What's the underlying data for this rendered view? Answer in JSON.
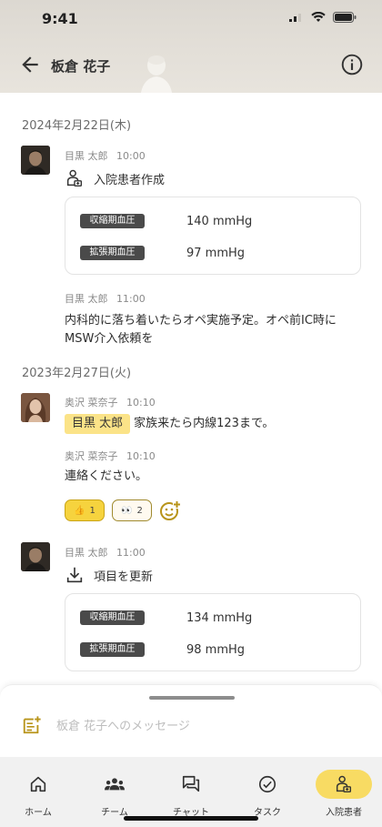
{
  "status_bar": {
    "time": "9:41"
  },
  "header": {
    "title": "板倉 花子"
  },
  "feed": {
    "groups": [
      {
        "date": "2024年2月22日(木)",
        "entries": [
          {
            "author": "目黒 太郎",
            "time": "10:00",
            "event": "入院患者作成",
            "vitals": [
              {
                "label": "収縮期血圧",
                "value": "140 mmHg"
              },
              {
                "label": "拡張期血圧",
                "value": "97 mmHg"
              }
            ]
          },
          {
            "author": "目黒 太郎",
            "time": "11:00",
            "text": "内科的に落ち着いたらオペ実施予定。オペ前IC時にMSW介入依頼を"
          }
        ]
      },
      {
        "date": "2023年2月27日(火)",
        "entries": [
          {
            "author": "奥沢 菜奈子",
            "time": "10:10",
            "mention": "目黒 太郎",
            "text": "家族来たら内線123まで。"
          },
          {
            "author": "奥沢 菜奈子",
            "time": "10:10",
            "text": "連絡ください。",
            "reactions": [
              {
                "emoji": "👍",
                "count": "1"
              },
              {
                "emoji": "👀",
                "count": "2"
              }
            ]
          },
          {
            "author": "目黒 太郎",
            "time": "11:00",
            "event": "項目を更新",
            "vitals": [
              {
                "label": "収縮期血圧",
                "value": "134 mmHg"
              },
              {
                "label": "拡張期血圧",
                "value": "98 mmHg"
              }
            ]
          }
        ]
      }
    ]
  },
  "composer": {
    "placeholder": "板倉 花子へのメッセージ"
  },
  "tabs": [
    {
      "label": "ホーム",
      "icon": "home-icon"
    },
    {
      "label": "チーム",
      "icon": "team-icon"
    },
    {
      "label": "チャット",
      "icon": "chat-icon"
    },
    {
      "label": "タスク",
      "icon": "task-icon"
    },
    {
      "label": "入院患者",
      "icon": "inpatient-icon",
      "active": true
    }
  ],
  "colors": {
    "accent": "#f8db63",
    "mention_bg": "#fbe388",
    "tag_bg": "#4a4a4a",
    "header_bg": "#e0dcd5"
  }
}
